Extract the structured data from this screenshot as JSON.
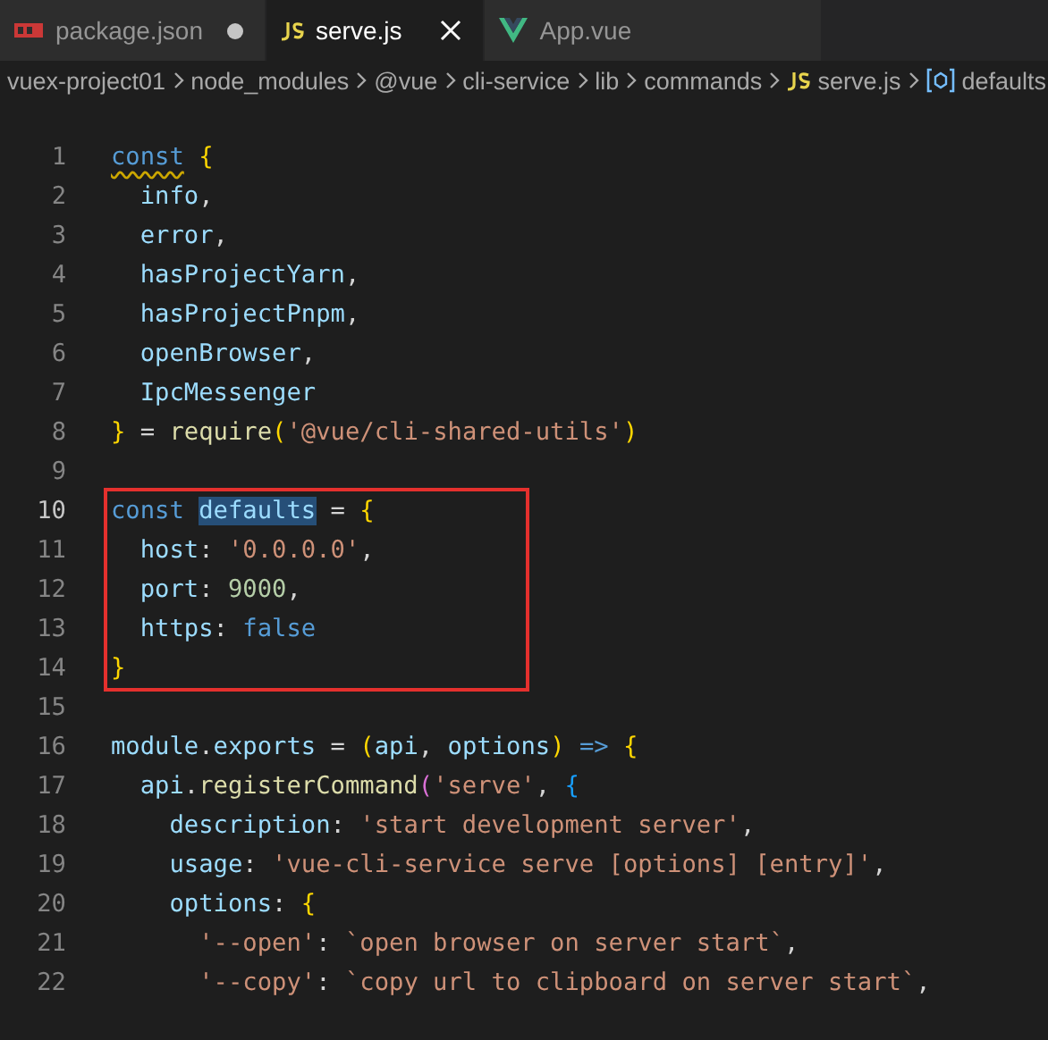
{
  "tabs": [
    {
      "label": "package.json",
      "kind": "npm",
      "selected": false,
      "dirty": true
    },
    {
      "label": "serve.js",
      "kind": "script",
      "selected": true,
      "dirty": false
    },
    {
      "label": "App.vue",
      "kind": "vue",
      "selected": false,
      "dirty": false
    }
  ],
  "breadcrumb": [
    {
      "label": "vuex-project01",
      "kind": "folder"
    },
    {
      "label": "node_modules",
      "kind": "folder"
    },
    {
      "label": "@vue",
      "kind": "folder"
    },
    {
      "label": "cli-service",
      "kind": "folder"
    },
    {
      "label": "lib",
      "kind": "folder"
    },
    {
      "label": "commands",
      "kind": "folder"
    },
    {
      "label": "serve.js",
      "kind": "script"
    },
    {
      "label": "defaults",
      "kind": "symbol"
    }
  ],
  "code_lines": [
    {
      "number": "1",
      "active": false,
      "boxed": false,
      "tokens": [
        {
          "text": "const",
          "kind": "warned"
        },
        {
          "text": " {",
          "kind": "brace"
        }
      ]
    },
    {
      "number": "2",
      "active": false,
      "boxed": false,
      "tokens": [
        {
          "text": "  info",
          "kind": "variable"
        },
        {
          "text": ",",
          "kind": "plain"
        }
      ]
    },
    {
      "number": "3",
      "active": false,
      "boxed": false,
      "tokens": [
        {
          "text": "  error",
          "kind": "variable"
        },
        {
          "text": ",",
          "kind": "plain"
        }
      ]
    },
    {
      "number": "4",
      "active": false,
      "boxed": false,
      "tokens": [
        {
          "text": "  hasProjectYarn",
          "kind": "variable"
        },
        {
          "text": ",",
          "kind": "plain"
        }
      ]
    },
    {
      "number": "5",
      "active": false,
      "boxed": false,
      "tokens": [
        {
          "text": "  hasProjectPnpm",
          "kind": "variable"
        },
        {
          "text": ",",
          "kind": "plain"
        }
      ]
    },
    {
      "number": "6",
      "active": false,
      "boxed": false,
      "tokens": [
        {
          "text": "  openBrowser",
          "kind": "variable"
        },
        {
          "text": ",",
          "kind": "plain"
        }
      ]
    },
    {
      "number": "7",
      "active": false,
      "boxed": false,
      "tokens": [
        {
          "text": "  IpcMessenger",
          "kind": "variable"
        }
      ]
    },
    {
      "number": "8",
      "active": false,
      "boxed": false,
      "tokens": [
        {
          "text": "}",
          "kind": "brace"
        },
        {
          "text": " = ",
          "kind": "plain"
        },
        {
          "text": "require",
          "kind": "function"
        },
        {
          "text": "(",
          "kind": "brace"
        },
        {
          "text": "'@vue/cli-shared-utils'",
          "kind": "string"
        },
        {
          "text": ")",
          "kind": "brace"
        }
      ]
    },
    {
      "number": "9",
      "active": false,
      "boxed": false
    },
    {
      "number": "10",
      "active": true,
      "boxed": true,
      "tokens": [
        {
          "text": "const ",
          "kind": "keyword"
        },
        {
          "text": "defaults",
          "kind": "selected"
        },
        {
          "text": " = ",
          "kind": "plain"
        },
        {
          "text": "{",
          "kind": "brace"
        }
      ]
    },
    {
      "number": "11",
      "active": false,
      "boxed": true,
      "tokens": [
        {
          "text": "  host",
          "kind": "variable"
        },
        {
          "text": ": ",
          "kind": "plain"
        },
        {
          "text": "'0.0.0.0'",
          "kind": "string"
        },
        {
          "text": ",",
          "kind": "plain"
        }
      ]
    },
    {
      "number": "12",
      "active": false,
      "boxed": true,
      "tokens": [
        {
          "text": "  port",
          "kind": "variable"
        },
        {
          "text": ": ",
          "kind": "plain"
        },
        {
          "text": "9000",
          "kind": "number"
        },
        {
          "text": ",",
          "kind": "plain"
        }
      ]
    },
    {
      "number": "13",
      "active": false,
      "boxed": true,
      "tokens": [
        {
          "text": "  https",
          "kind": "variable"
        },
        {
          "text": ": ",
          "kind": "plain"
        },
        {
          "text": "false",
          "kind": "keyword"
        }
      ]
    },
    {
      "number": "14",
      "active": false,
      "boxed": true,
      "tokens": [
        {
          "text": "}",
          "kind": "brace"
        }
      ]
    },
    {
      "number": "15",
      "active": false,
      "boxed": false
    },
    {
      "number": "16",
      "active": false,
      "boxed": false,
      "tokens": [
        {
          "text": "module",
          "kind": "variable"
        },
        {
          "text": ".",
          "kind": "plain"
        },
        {
          "text": "exports",
          "kind": "variable"
        },
        {
          "text": " = ",
          "kind": "plain"
        },
        {
          "text": "(",
          "kind": "brace"
        },
        {
          "text": "api",
          "kind": "variable"
        },
        {
          "text": ", ",
          "kind": "plain"
        },
        {
          "text": "options",
          "kind": "variable"
        },
        {
          "text": ")",
          "kind": "brace"
        },
        {
          "text": " =>",
          "kind": "keyword"
        },
        {
          "text": " {",
          "kind": "brace"
        }
      ]
    },
    {
      "number": "17",
      "active": false,
      "boxed": false,
      "tokens": [
        {
          "text": "  api",
          "kind": "variable"
        },
        {
          "text": ".",
          "kind": "plain"
        },
        {
          "text": "registerCommand",
          "kind": "function"
        },
        {
          "text": "(",
          "kind": "paren"
        },
        {
          "text": "'serve'",
          "kind": "string"
        },
        {
          "text": ", ",
          "kind": "plain"
        },
        {
          "text": "{",
          "kind": "bracket"
        }
      ]
    },
    {
      "number": "18",
      "active": false,
      "boxed": false,
      "tokens": [
        {
          "text": "    description",
          "kind": "variable"
        },
        {
          "text": ": ",
          "kind": "plain"
        },
        {
          "text": "'start development server'",
          "kind": "string"
        },
        {
          "text": ",",
          "kind": "plain"
        }
      ]
    },
    {
      "number": "19",
      "active": false,
      "boxed": false,
      "tokens": [
        {
          "text": "    usage",
          "kind": "variable"
        },
        {
          "text": ": ",
          "kind": "plain"
        },
        {
          "text": "'vue-cli-service serve [options] [entry]'",
          "kind": "string"
        },
        {
          "text": ",",
          "kind": "plain"
        }
      ]
    },
    {
      "number": "20",
      "active": false,
      "boxed": false,
      "tokens": [
        {
          "text": "    options",
          "kind": "variable"
        },
        {
          "text": ": ",
          "kind": "plain"
        },
        {
          "text": "{",
          "kind": "brace"
        }
      ]
    },
    {
      "number": "21",
      "active": false,
      "boxed": false,
      "tokens": [
        {
          "text": "      '--open'",
          "kind": "string"
        },
        {
          "text": ": ",
          "kind": "plain"
        },
        {
          "text": "`open browser on server start`",
          "kind": "string"
        },
        {
          "text": ",",
          "kind": "plain"
        }
      ]
    },
    {
      "number": "22",
      "active": false,
      "boxed": false,
      "tokens": [
        {
          "text": "      '--copy'",
          "kind": "string"
        },
        {
          "text": ": ",
          "kind": "plain"
        },
        {
          "text": "`copy url to clipboard on server start`",
          "kind": "string"
        },
        {
          "text": ",",
          "kind": "plain"
        }
      ]
    }
  ]
}
